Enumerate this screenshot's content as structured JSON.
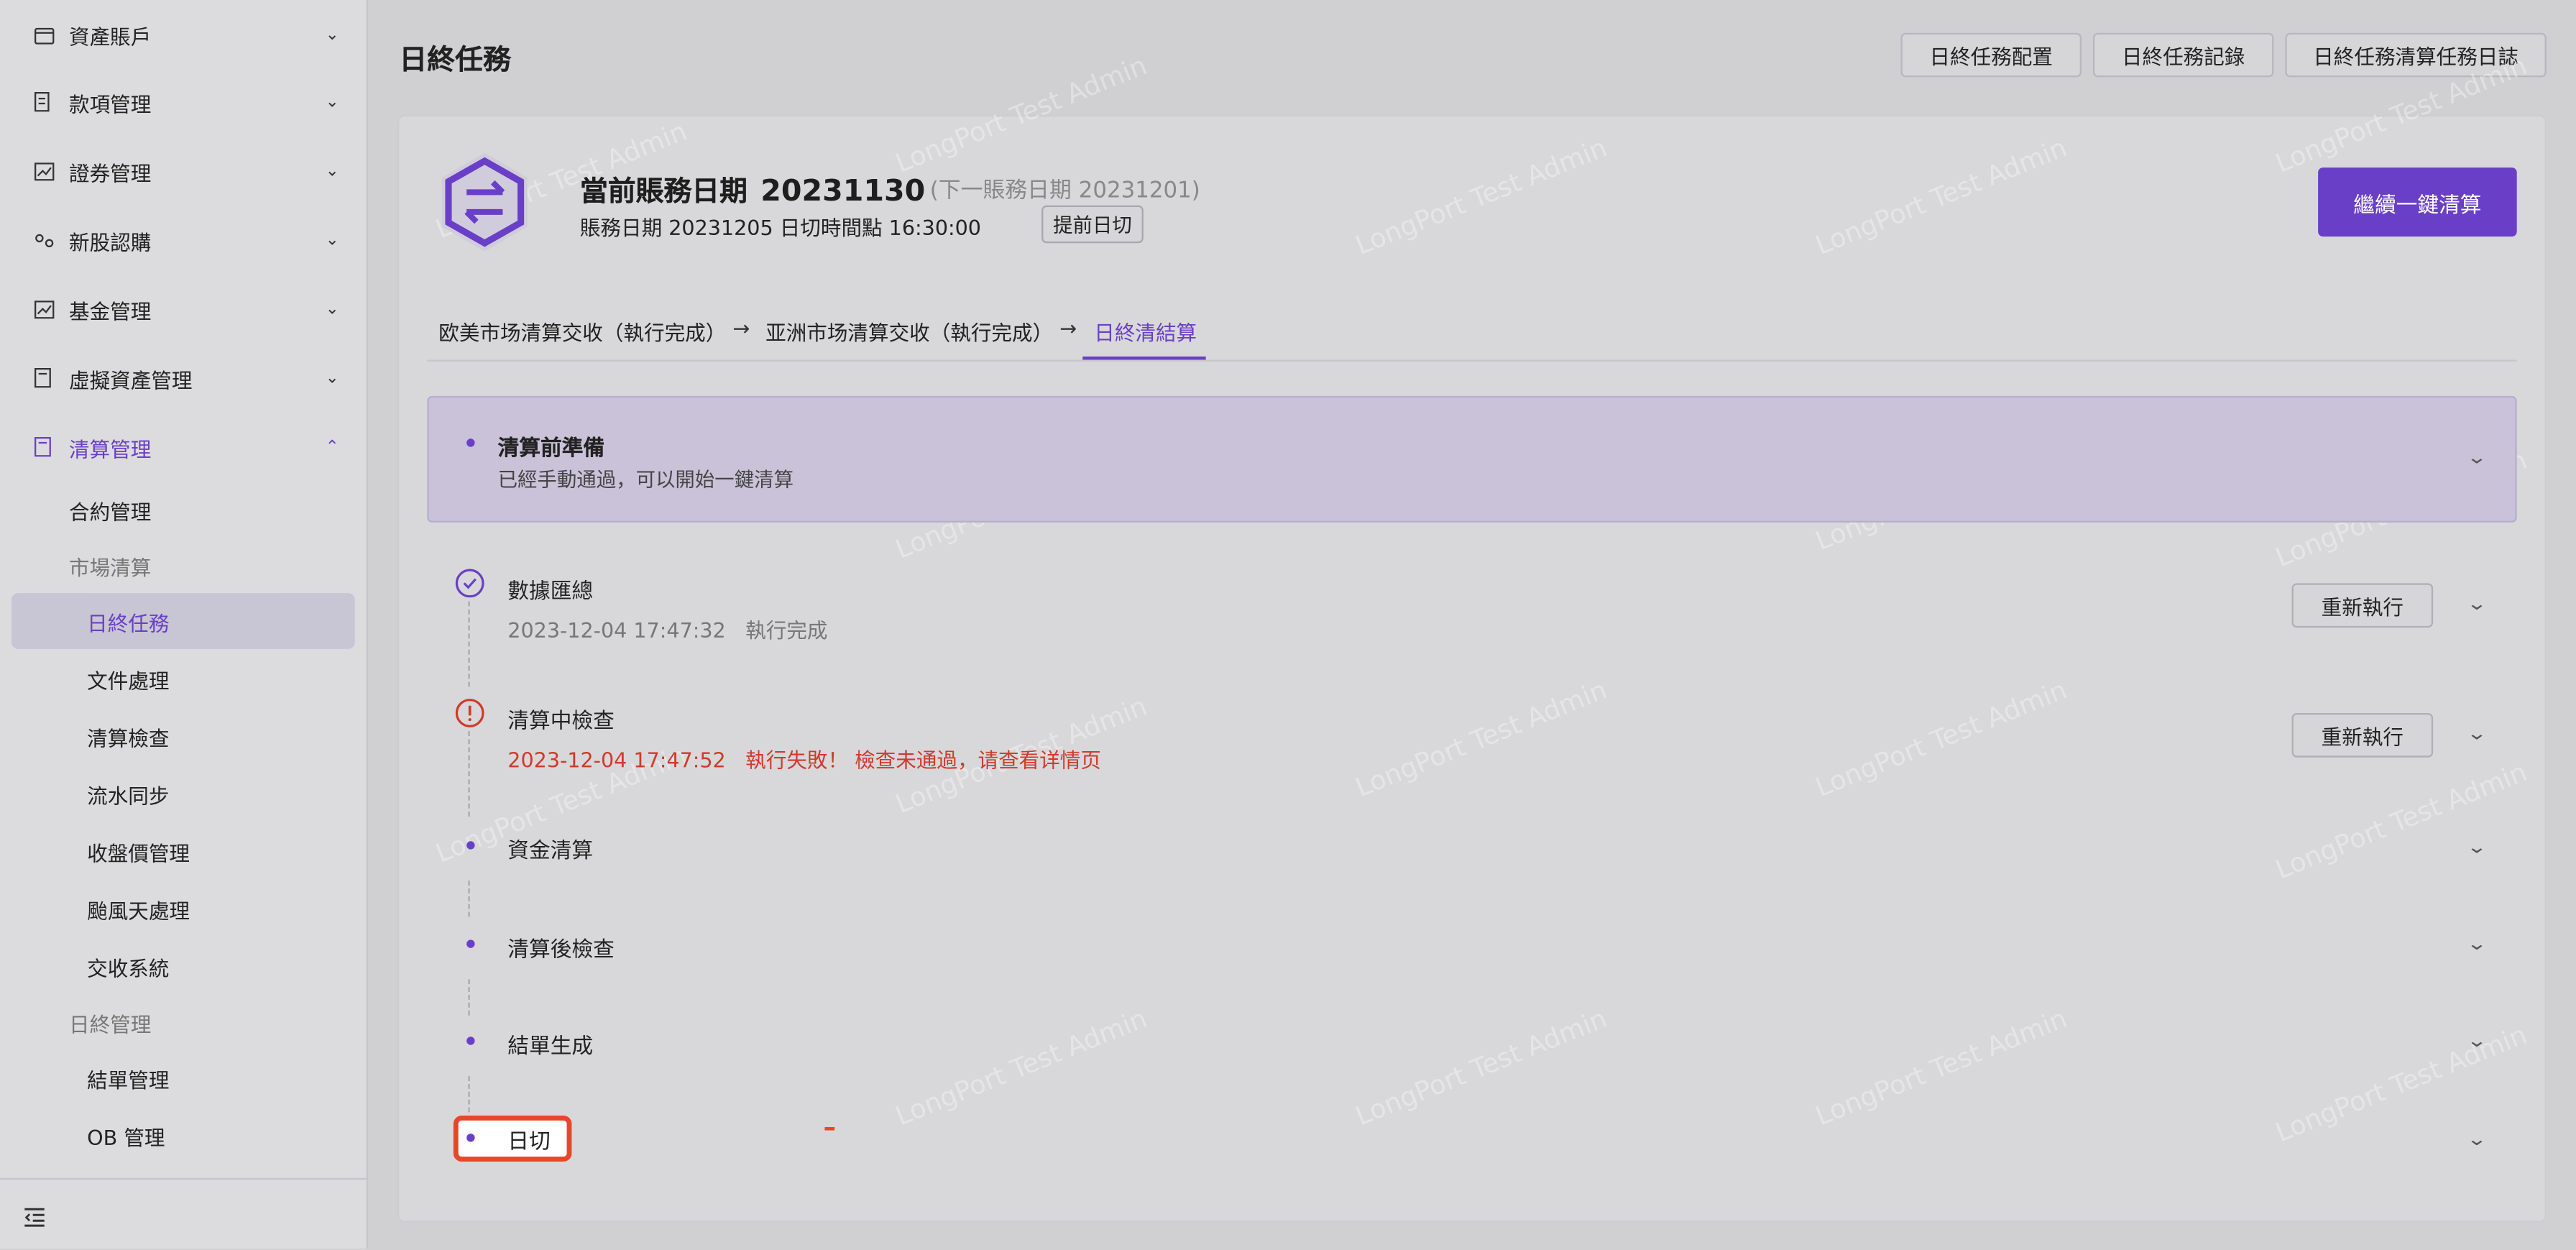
{
  "sidebar": {
    "menu": [
      {
        "label": "資產賬戶",
        "icon": "wallet-icon"
      },
      {
        "label": "款項管理",
        "icon": "receipt-icon"
      },
      {
        "label": "證券管理",
        "icon": "stock-chart-icon"
      },
      {
        "label": "新股認購",
        "icon": "ipo-icon"
      },
      {
        "label": "基金管理",
        "icon": "fund-chart-icon"
      },
      {
        "label": "虛擬資產管理",
        "icon": "calculator-icon"
      },
      {
        "label": "清算管理",
        "icon": "clearing-icon"
      }
    ],
    "clearing_sub": {
      "contract": "合約管理",
      "market_group": "市場清算",
      "market_items": [
        "日終任務",
        "文件處理",
        "清算檢查",
        "流水同步",
        "收盤價管理",
        "颱風天處理",
        "交收系統"
      ],
      "eod_group": "日終管理",
      "eod_items": [
        "結單管理",
        "OB 管理"
      ]
    },
    "selected_item": "日終任務"
  },
  "header": {
    "title": "日終任務",
    "buttons": [
      "日終任務配置",
      "日終任務記錄",
      "日終任務清算任務日誌"
    ]
  },
  "summary": {
    "date_label": "當前賬務日期",
    "date_value": "20231130",
    "next_date": "(下一賬務日期   20231201)",
    "sub_info": "賬務日期 20231205   日切時間點 16:30:00",
    "early_cutoff_button": "提前日切",
    "continue_button": "繼續一鍵清算"
  },
  "steps_nav": {
    "step1": "欧美市场清算交收（執行完成）",
    "step2": "亚洲市场清算交收（執行完成）",
    "step3": "日終清結算",
    "arrow": "→"
  },
  "prep": {
    "title": "清算前準備",
    "desc": "已經手動通過，可以開始一鍵清算"
  },
  "tasks": [
    {
      "title": "數據匯總",
      "time": "2023-12-04 17:47:32",
      "status": "執行完成",
      "state": "success"
    },
    {
      "title": "清算中檢查",
      "time": "2023-12-04 17:47:52",
      "status": "執行失敗！ 檢查未通過，请查看详情页",
      "state": "error"
    },
    {
      "title": "資金清算",
      "state": "pending"
    },
    {
      "title": "清算後檢查",
      "state": "pending"
    },
    {
      "title": "結單生成",
      "state": "pending"
    },
    {
      "title": "日切",
      "state": "pending"
    }
  ],
  "rerun_label": "重新執行",
  "watermark": "LongPort Test Admin",
  "colors": {
    "accent": "#6a3fc7",
    "error": "#d03a2a",
    "highlight": "#e8462a"
  }
}
